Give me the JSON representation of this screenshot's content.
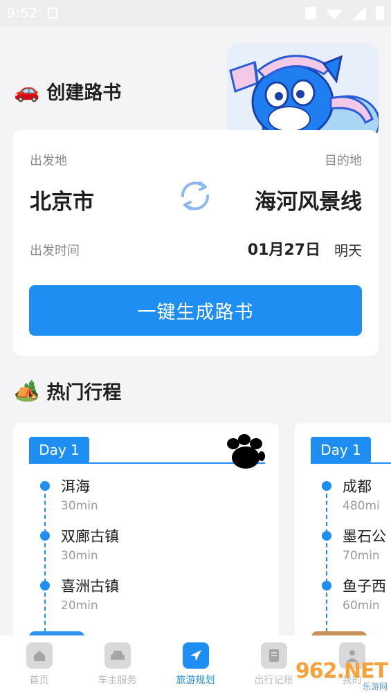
{
  "status_bar": {
    "time": "9:52"
  },
  "create_section": {
    "emoji": "🚗",
    "title": "创建路书"
  },
  "plan": {
    "from_label": "出发地",
    "to_label": "目的地",
    "from_city": "北京市",
    "to_city": "海河风景线",
    "time_label": "出发时间",
    "date": "01月27日",
    "day_hint": "明天",
    "generate_button": "一键生成路书"
  },
  "hot_section": {
    "emoji": "🏕️",
    "title": "热门行程"
  },
  "trips": [
    {
      "day": "Day 1",
      "stops": [
        {
          "name": "洱海",
          "duration": "30min"
        },
        {
          "name": "双廊古镇",
          "duration": "30min"
        },
        {
          "name": "喜洲古镇",
          "duration": "20min"
        }
      ]
    },
    {
      "day": "Day 1",
      "stops": [
        {
          "name": "成都",
          "duration": "480mi"
        },
        {
          "name": "墨石公",
          "duration": "70min"
        },
        {
          "name": "鱼子西",
          "duration": "60min"
        }
      ]
    }
  ],
  "tabs": [
    {
      "label": "首页",
      "icon": "home-icon"
    },
    {
      "label": "车主服务",
      "icon": "car-icon"
    },
    {
      "label": "旅游规划",
      "icon": "navigation-arrow-icon",
      "active": true
    },
    {
      "label": "出行记账",
      "icon": "ledger-icon"
    },
    {
      "label": "我的",
      "icon": "user-icon"
    }
  ],
  "watermark": {
    "main": "962.NET",
    "sub": "乐游网"
  },
  "colors": {
    "accent": "#1e8ef3",
    "background": "#f4f4f6"
  }
}
